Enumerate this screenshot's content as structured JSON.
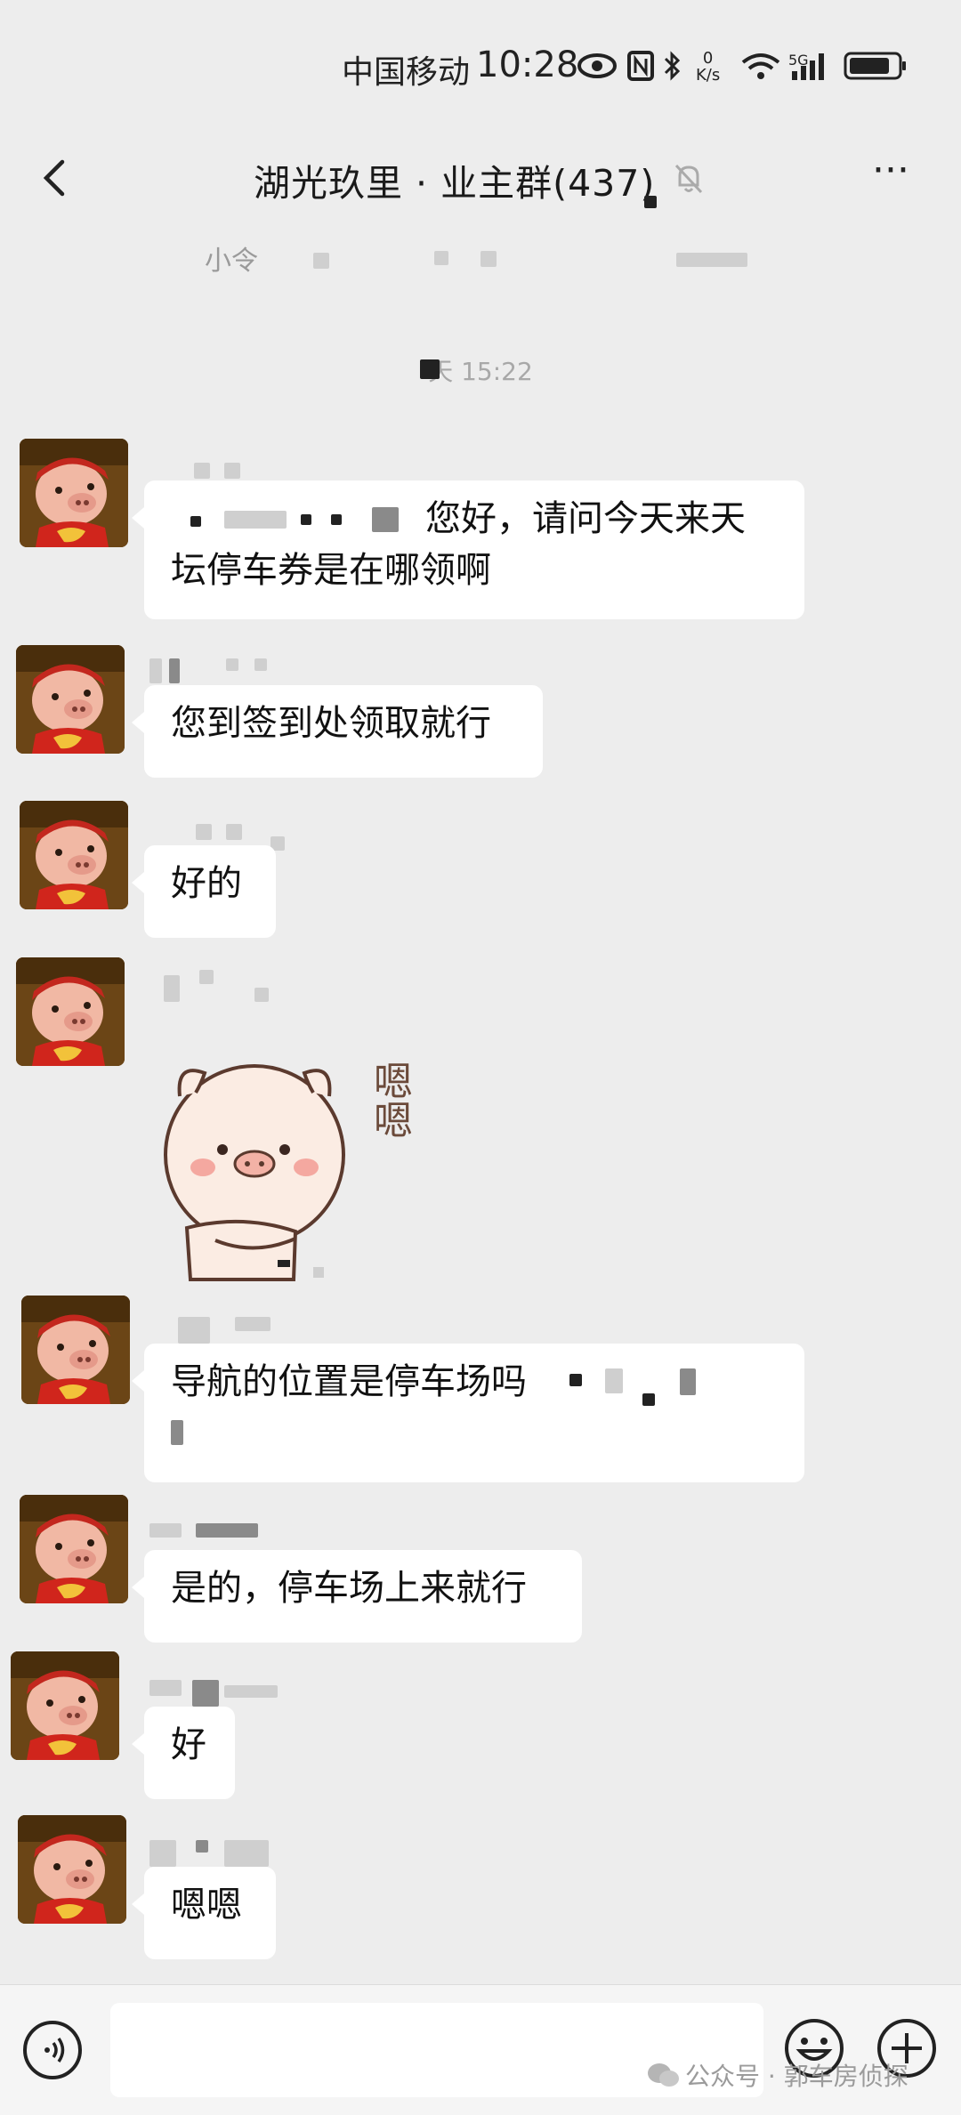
{
  "status_bar": {
    "carrier": "中国移动",
    "time": "10:28",
    "net_speed_value": "0",
    "net_speed_unit": "K/s",
    "network_type": "5G",
    "icons": [
      "eye-icon",
      "nfc-icon",
      "bluetooth-icon",
      "wifi-icon",
      "signal-icon",
      "battery-icon"
    ]
  },
  "header": {
    "title": "湖光玖里 · 业主群(437)",
    "back_icon": "back-arrow-icon",
    "mute_icon": "bell-muted-icon",
    "more_label": "···"
  },
  "notice": {
    "text": "小令"
  },
  "timestamp": "天 15:22",
  "messages": [
    {
      "text_line1": "您好，请问今天来天",
      "text_line2": "坛停车券是在哪领啊"
    },
    {
      "text": "您到签到处领取就行"
    },
    {
      "text": "好的"
    },
    {
      "sticker_caption": "嗯嗯",
      "sticker": "pig-sticker"
    },
    {
      "text_line1": "导航的位置是停车场吗"
    },
    {
      "text": "是的，停车场上来就行"
    },
    {
      "text": "好"
    },
    {
      "text": "嗯嗯"
    }
  ],
  "input_bar": {
    "placeholder": "",
    "voice_icon": "voice-icon",
    "emoji_icon": "emoji-icon",
    "plus_icon": "plus-icon"
  },
  "watermark": {
    "text": "公众号 · 郭车房侦探"
  },
  "colors": {
    "background": "#ededed",
    "bubble": "#ffffff",
    "avatar_bg": "#5c3b16"
  }
}
